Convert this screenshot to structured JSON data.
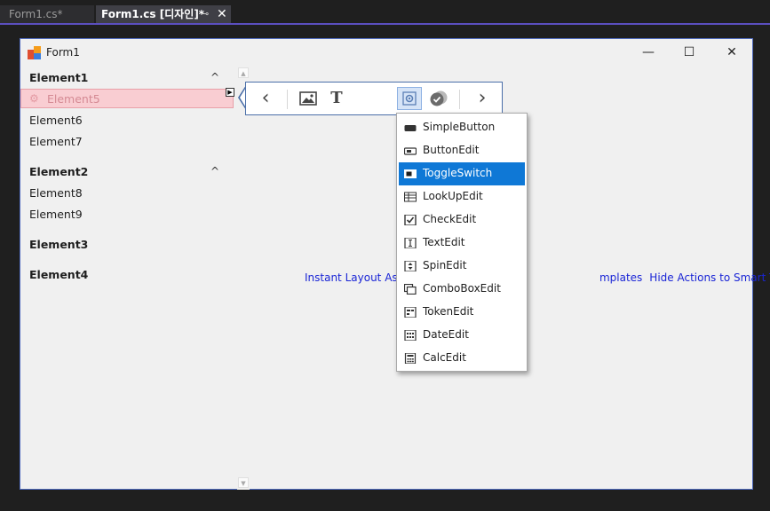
{
  "ide": {
    "tabs": [
      {
        "label": "Form1.cs*"
      },
      {
        "label": "Form1.cs [디자인]*",
        "pin_glyph": "⊸",
        "close_glyph": "✕"
      }
    ],
    "accent_color": "#5b4fbf"
  },
  "form": {
    "title": "Form1",
    "window_buttons": {
      "minimize": "—",
      "maximize": "☐",
      "close": "✕"
    }
  },
  "accordion": {
    "groups": [
      {
        "label": "Element1",
        "expanded": true,
        "chevron": "^",
        "items": [
          "Element5",
          "Element6",
          "Element7"
        ]
      },
      {
        "label": "Element2",
        "expanded": true,
        "chevron": "^",
        "items": [
          "Element8",
          "Element9"
        ]
      },
      {
        "label": "Element3",
        "expanded": false
      },
      {
        "label": "Element4",
        "expanded": false
      }
    ],
    "selected_item": "Element5",
    "selected_bg": "#f9cdd2"
  },
  "toolbar": {
    "buttons": [
      "chevron-left",
      "image",
      "text",
      "gear",
      "check-circle",
      "chevron-right"
    ],
    "glyphs": {
      "prev": "‹",
      "text": "T",
      "next": "›"
    }
  },
  "links": [
    "Instant Layout Ass",
    "mplates",
    "Hide Actions to Smart Tag"
  ],
  "dropdown": {
    "items": [
      {
        "label": "SimpleButton",
        "icon": "simplebutton-icon"
      },
      {
        "label": "ButtonEdit",
        "icon": "buttonedit-icon"
      },
      {
        "label": "ToggleSwitch",
        "icon": "toggleswitch-icon",
        "selected": true
      },
      {
        "label": "LookUpEdit",
        "icon": "lookupedit-icon"
      },
      {
        "label": "CheckEdit",
        "icon": "checkedit-icon"
      },
      {
        "label": "TextEdit",
        "icon": "textedit-icon"
      },
      {
        "label": "SpinEdit",
        "icon": "spinedit-icon"
      },
      {
        "label": "ComboBoxEdit",
        "icon": "comboboxedit-icon"
      },
      {
        "label": "TokenEdit",
        "icon": "tokenedit-icon"
      },
      {
        "label": "DateEdit",
        "icon": "dateedit-icon"
      },
      {
        "label": "CalcEdit",
        "icon": "calcedit-icon"
      }
    ],
    "selected_color": "#0f78d6"
  }
}
